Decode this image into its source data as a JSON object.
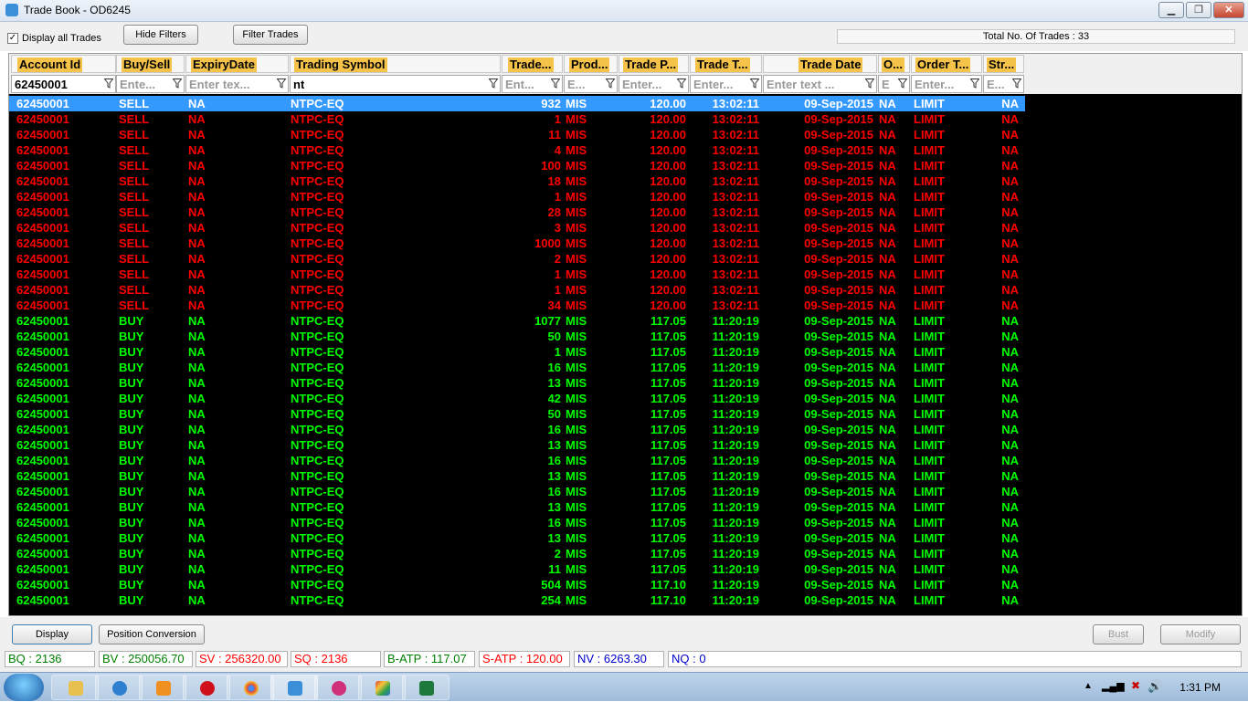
{
  "window": {
    "title": "Trade Book - OD6245"
  },
  "toolbar": {
    "display_all_trades_label": "Display all Trades",
    "display_all_trades_checked": true,
    "hide_filters_label": "Hide Filters",
    "filter_trades_label": "Filter Trades",
    "total_label": "Total No. Of Trades : 33"
  },
  "columns": [
    {
      "id": "account",
      "label": "Account Id",
      "filter": "62450001",
      "filter_filled": true
    },
    {
      "id": "side",
      "label": "Buy/Sell",
      "filter": "Ente...",
      "filter_filled": false
    },
    {
      "id": "expiry",
      "label": "ExpiryDate",
      "filter": "Enter tex...",
      "filter_filled": false
    },
    {
      "id": "symbol",
      "label": "Trading Symbol",
      "filter": "nt",
      "filter_filled": true
    },
    {
      "id": "qty",
      "label": "Trade...",
      "filter": "Ent...",
      "filter_filled": false
    },
    {
      "id": "prod",
      "label": "Prod...",
      "filter": "E...",
      "filter_filled": false
    },
    {
      "id": "price",
      "label": "Trade P...",
      "filter": "Enter...",
      "filter_filled": false
    },
    {
      "id": "time",
      "label": "Trade T...",
      "filter": "Enter...",
      "filter_filled": false
    },
    {
      "id": "date",
      "label": "Trade Date",
      "filter": "Enter text ...",
      "filter_filled": false
    },
    {
      "id": "o",
      "label": "O...",
      "filter": "E",
      "filter_filled": false
    },
    {
      "id": "order_type",
      "label": "Order T...",
      "filter": "Enter...",
      "filter_filled": false
    },
    {
      "id": "strike",
      "label": "Str...",
      "filter": "E...",
      "filter_filled": false
    }
  ],
  "trades": [
    [
      "62450001",
      "SELL",
      "NA",
      "NTPC-EQ",
      "932",
      "MIS",
      "120.00",
      "13:02:11",
      "09-Sep-2015",
      "NA",
      "LIMIT",
      "NA"
    ],
    [
      "62450001",
      "SELL",
      "NA",
      "NTPC-EQ",
      "1",
      "MIS",
      "120.00",
      "13:02:11",
      "09-Sep-2015",
      "NA",
      "LIMIT",
      "NA"
    ],
    [
      "62450001",
      "SELL",
      "NA",
      "NTPC-EQ",
      "11",
      "MIS",
      "120.00",
      "13:02:11",
      "09-Sep-2015",
      "NA",
      "LIMIT",
      "NA"
    ],
    [
      "62450001",
      "SELL",
      "NA",
      "NTPC-EQ",
      "4",
      "MIS",
      "120.00",
      "13:02:11",
      "09-Sep-2015",
      "NA",
      "LIMIT",
      "NA"
    ],
    [
      "62450001",
      "SELL",
      "NA",
      "NTPC-EQ",
      "100",
      "MIS",
      "120.00",
      "13:02:11",
      "09-Sep-2015",
      "NA",
      "LIMIT",
      "NA"
    ],
    [
      "62450001",
      "SELL",
      "NA",
      "NTPC-EQ",
      "18",
      "MIS",
      "120.00",
      "13:02:11",
      "09-Sep-2015",
      "NA",
      "LIMIT",
      "NA"
    ],
    [
      "62450001",
      "SELL",
      "NA",
      "NTPC-EQ",
      "1",
      "MIS",
      "120.00",
      "13:02:11",
      "09-Sep-2015",
      "NA",
      "LIMIT",
      "NA"
    ],
    [
      "62450001",
      "SELL",
      "NA",
      "NTPC-EQ",
      "28",
      "MIS",
      "120.00",
      "13:02:11",
      "09-Sep-2015",
      "NA",
      "LIMIT",
      "NA"
    ],
    [
      "62450001",
      "SELL",
      "NA",
      "NTPC-EQ",
      "3",
      "MIS",
      "120.00",
      "13:02:11",
      "09-Sep-2015",
      "NA",
      "LIMIT",
      "NA"
    ],
    [
      "62450001",
      "SELL",
      "NA",
      "NTPC-EQ",
      "1000",
      "MIS",
      "120.00",
      "13:02:11",
      "09-Sep-2015",
      "NA",
      "LIMIT",
      "NA"
    ],
    [
      "62450001",
      "SELL",
      "NA",
      "NTPC-EQ",
      "2",
      "MIS",
      "120.00",
      "13:02:11",
      "09-Sep-2015",
      "NA",
      "LIMIT",
      "NA"
    ],
    [
      "62450001",
      "SELL",
      "NA",
      "NTPC-EQ",
      "1",
      "MIS",
      "120.00",
      "13:02:11",
      "09-Sep-2015",
      "NA",
      "LIMIT",
      "NA"
    ],
    [
      "62450001",
      "SELL",
      "NA",
      "NTPC-EQ",
      "1",
      "MIS",
      "120.00",
      "13:02:11",
      "09-Sep-2015",
      "NA",
      "LIMIT",
      "NA"
    ],
    [
      "62450001",
      "SELL",
      "NA",
      "NTPC-EQ",
      "34",
      "MIS",
      "120.00",
      "13:02:11",
      "09-Sep-2015",
      "NA",
      "LIMIT",
      "NA"
    ],
    [
      "62450001",
      "BUY",
      "NA",
      "NTPC-EQ",
      "1077",
      "MIS",
      "117.05",
      "11:20:19",
      "09-Sep-2015",
      "NA",
      "LIMIT",
      "NA"
    ],
    [
      "62450001",
      "BUY",
      "NA",
      "NTPC-EQ",
      "50",
      "MIS",
      "117.05",
      "11:20:19",
      "09-Sep-2015",
      "NA",
      "LIMIT",
      "NA"
    ],
    [
      "62450001",
      "BUY",
      "NA",
      "NTPC-EQ",
      "1",
      "MIS",
      "117.05",
      "11:20:19",
      "09-Sep-2015",
      "NA",
      "LIMIT",
      "NA"
    ],
    [
      "62450001",
      "BUY",
      "NA",
      "NTPC-EQ",
      "16",
      "MIS",
      "117.05",
      "11:20:19",
      "09-Sep-2015",
      "NA",
      "LIMIT",
      "NA"
    ],
    [
      "62450001",
      "BUY",
      "NA",
      "NTPC-EQ",
      "13",
      "MIS",
      "117.05",
      "11:20:19",
      "09-Sep-2015",
      "NA",
      "LIMIT",
      "NA"
    ],
    [
      "62450001",
      "BUY",
      "NA",
      "NTPC-EQ",
      "42",
      "MIS",
      "117.05",
      "11:20:19",
      "09-Sep-2015",
      "NA",
      "LIMIT",
      "NA"
    ],
    [
      "62450001",
      "BUY",
      "NA",
      "NTPC-EQ",
      "50",
      "MIS",
      "117.05",
      "11:20:19",
      "09-Sep-2015",
      "NA",
      "LIMIT",
      "NA"
    ],
    [
      "62450001",
      "BUY",
      "NA",
      "NTPC-EQ",
      "16",
      "MIS",
      "117.05",
      "11:20:19",
      "09-Sep-2015",
      "NA",
      "LIMIT",
      "NA"
    ],
    [
      "62450001",
      "BUY",
      "NA",
      "NTPC-EQ",
      "13",
      "MIS",
      "117.05",
      "11:20:19",
      "09-Sep-2015",
      "NA",
      "LIMIT",
      "NA"
    ],
    [
      "62450001",
      "BUY",
      "NA",
      "NTPC-EQ",
      "16",
      "MIS",
      "117.05",
      "11:20:19",
      "09-Sep-2015",
      "NA",
      "LIMIT",
      "NA"
    ],
    [
      "62450001",
      "BUY",
      "NA",
      "NTPC-EQ",
      "13",
      "MIS",
      "117.05",
      "11:20:19",
      "09-Sep-2015",
      "NA",
      "LIMIT",
      "NA"
    ],
    [
      "62450001",
      "BUY",
      "NA",
      "NTPC-EQ",
      "16",
      "MIS",
      "117.05",
      "11:20:19",
      "09-Sep-2015",
      "NA",
      "LIMIT",
      "NA"
    ],
    [
      "62450001",
      "BUY",
      "NA",
      "NTPC-EQ",
      "13",
      "MIS",
      "117.05",
      "11:20:19",
      "09-Sep-2015",
      "NA",
      "LIMIT",
      "NA"
    ],
    [
      "62450001",
      "BUY",
      "NA",
      "NTPC-EQ",
      "16",
      "MIS",
      "117.05",
      "11:20:19",
      "09-Sep-2015",
      "NA",
      "LIMIT",
      "NA"
    ],
    [
      "62450001",
      "BUY",
      "NA",
      "NTPC-EQ",
      "13",
      "MIS",
      "117.05",
      "11:20:19",
      "09-Sep-2015",
      "NA",
      "LIMIT",
      "NA"
    ],
    [
      "62450001",
      "BUY",
      "NA",
      "NTPC-EQ",
      "2",
      "MIS",
      "117.05",
      "11:20:19",
      "09-Sep-2015",
      "NA",
      "LIMIT",
      "NA"
    ],
    [
      "62450001",
      "BUY",
      "NA",
      "NTPC-EQ",
      "11",
      "MIS",
      "117.05",
      "11:20:19",
      "09-Sep-2015",
      "NA",
      "LIMIT",
      "NA"
    ],
    [
      "62450001",
      "BUY",
      "NA",
      "NTPC-EQ",
      "504",
      "MIS",
      "117.10",
      "11:20:19",
      "09-Sep-2015",
      "NA",
      "LIMIT",
      "NA"
    ],
    [
      "62450001",
      "BUY",
      "NA",
      "NTPC-EQ",
      "254",
      "MIS",
      "117.10",
      "11:20:19",
      "09-Sep-2015",
      "NA",
      "LIMIT",
      "NA"
    ]
  ],
  "selected_row": 0,
  "colors": {
    "sell": "#ff0000",
    "buy": "#00ff00",
    "selected_bg": "#3399ff",
    "selected_text": "#ffffff",
    "grid_bg": "#000000",
    "header_label_bg": "#f5c24a"
  },
  "actions": {
    "display_label": "Display",
    "position_conversion_label": "Position Conversion",
    "bust_label": "Bust",
    "modify_label": "Modify"
  },
  "status": [
    {
      "name": "bq",
      "text": "BQ : 2136",
      "color": "#008000"
    },
    {
      "name": "bv",
      "text": "BV : 250056.70",
      "color": "#008000"
    },
    {
      "name": "sv",
      "text": "SV : 256320.00",
      "color": "#ff0000"
    },
    {
      "name": "sq",
      "text": "SQ : 2136",
      "color": "#ff0000"
    },
    {
      "name": "b-atp",
      "text": "B-ATP : 117.07",
      "color": "#008000"
    },
    {
      "name": "s-atp",
      "text": "S-ATP : 120.00",
      "color": "#ff0000"
    },
    {
      "name": "nv",
      "text": "NV : 6263.30",
      "color": "#0000cc"
    },
    {
      "name": "nq",
      "text": "NQ : 0",
      "color": "#0000cc"
    }
  ],
  "taskbar": {
    "clock": "1:31 PM"
  }
}
